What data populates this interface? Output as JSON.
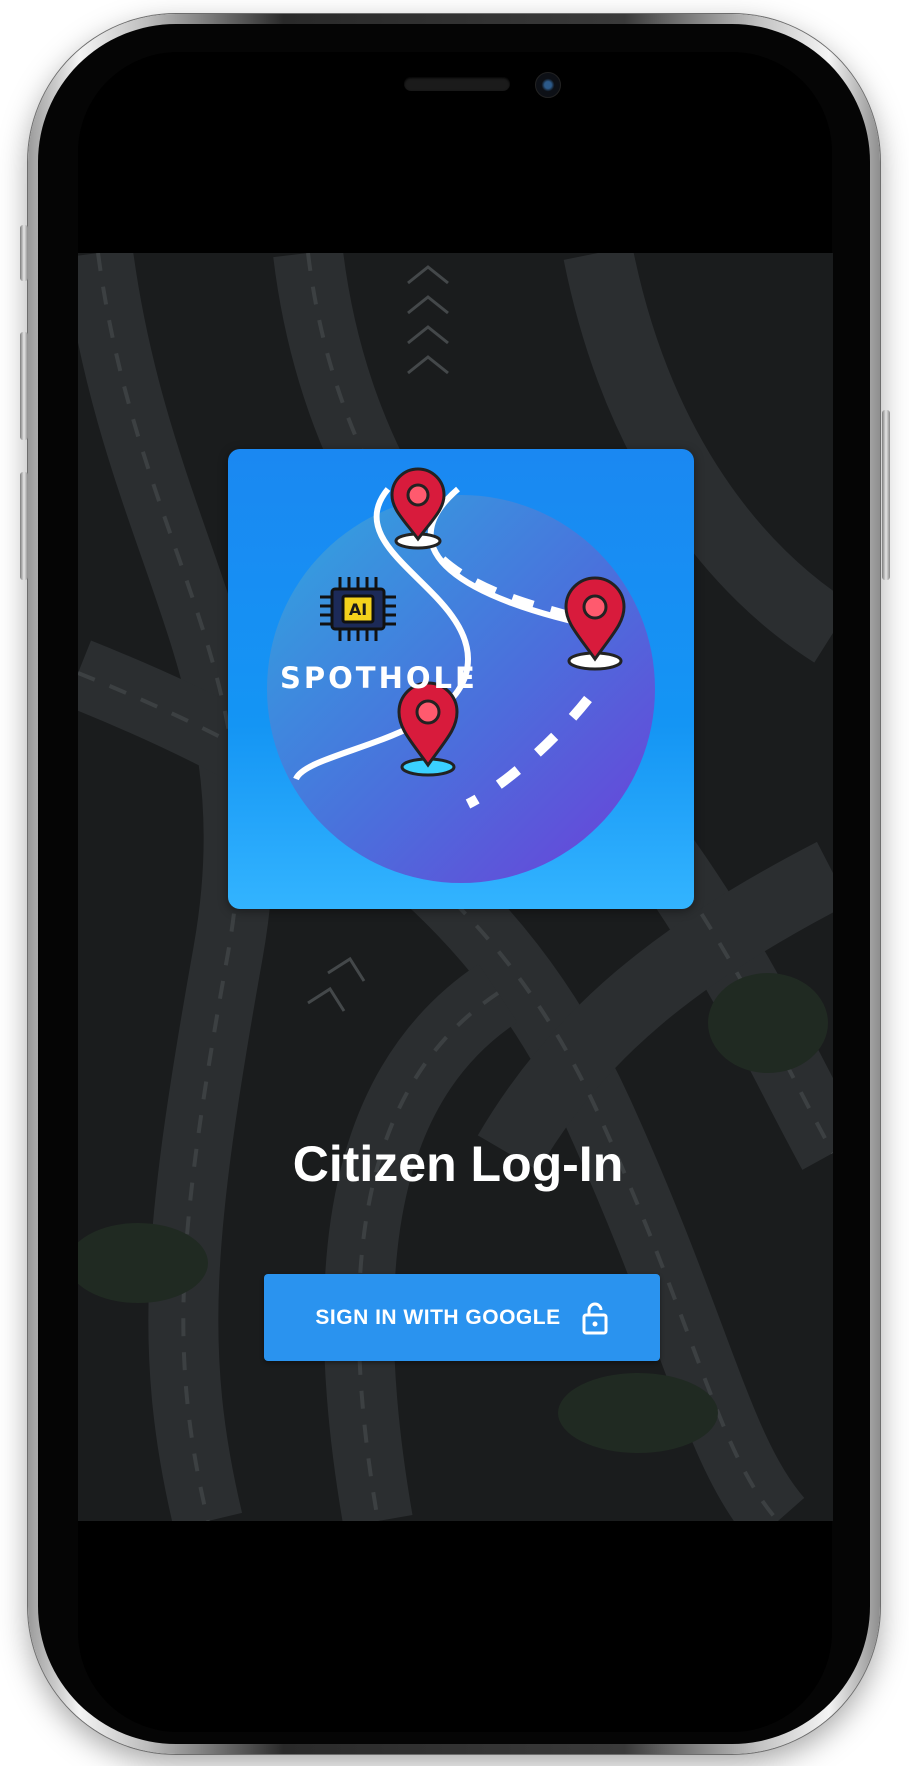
{
  "app": {
    "brand": {
      "name": "SPOTHOLE",
      "chip_label": "AI"
    },
    "title": "Citizen Log-In",
    "signin_button": {
      "label": "SIGN IN WITH GOOGLE",
      "icon": "lock-open-icon"
    }
  },
  "colors": {
    "button": "#2a93ef",
    "card": "#1a88f2",
    "pin": "#d81b3c",
    "background": "#17191a"
  }
}
